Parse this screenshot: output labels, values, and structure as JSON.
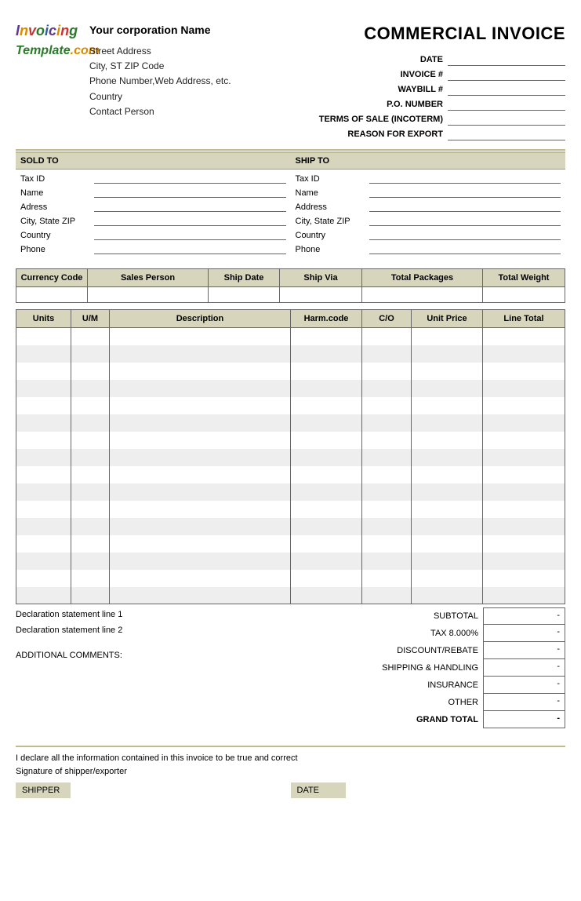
{
  "logo": {
    "line1_html": "Invoicing",
    "line2_html": "Template.com"
  },
  "company": {
    "name": "Your corporation  Name",
    "street": "Street Address",
    "city": "City, ST  ZIP Code",
    "phone": "Phone Number,Web Address, etc.",
    "country": "Country",
    "contact": "Contact Person"
  },
  "title": "COMMERCIAL INVOICE",
  "meta": {
    "date_lbl": "DATE",
    "date": "",
    "invoice_lbl": "INVOICE #",
    "invoice": "",
    "waybill_lbl": "WAYBILL #",
    "waybill": "",
    "po_lbl": "P.O. NUMBER",
    "po": "",
    "terms_lbl": "TERMS OF SALE (INCOTERM)",
    "terms": "",
    "reason_lbl": "REASON FOR EXPORT",
    "reason": ""
  },
  "sold": {
    "header": "SOLD  TO",
    "fields": {
      "taxid_lbl": "Tax ID",
      "taxid": "",
      "name_lbl": "Name",
      "name": "",
      "address_lbl": "Adress",
      "address": "",
      "csz_lbl": "City, State ZIP",
      "csz": "",
      "country_lbl": "Country",
      "country": "",
      "phone_lbl": "Phone",
      "phone": ""
    }
  },
  "ship": {
    "header": "SHIP TO",
    "fields": {
      "taxid_lbl": "Tax ID",
      "taxid": "",
      "name_lbl": "Name",
      "name": "",
      "address_lbl": "Address",
      "address": "",
      "csz_lbl": "City, State ZIP",
      "csz": "",
      "country_lbl": "Country",
      "country": "",
      "phone_lbl": "Phone",
      "phone": ""
    }
  },
  "info": {
    "h": {
      "currency": "Currency Code",
      "sales": "Sales Person",
      "shipdate": "Ship Date",
      "shipvia": "Ship Via",
      "packages": "Total Packages",
      "weight": "Total Weight"
    },
    "v": {
      "currency": "",
      "sales": "",
      "shipdate": "",
      "shipvia": "",
      "packages": "",
      "weight": ""
    }
  },
  "items": {
    "h": {
      "units": "Units",
      "um": "U/M",
      "desc": "Description",
      "harm": "Harm.code",
      "co": "C/O",
      "price": "Unit Price",
      "line": "Line Total"
    }
  },
  "decl": {
    "l1": "Declaration statement line 1",
    "l2": "Declaration statement line 2"
  },
  "addc_lbl": "ADDITIONAL COMMENTS:",
  "totals": {
    "subtotal_lbl": "SUBTOTAL",
    "subtotal": "-",
    "tax_lbl": "TAX  8.000%",
    "tax": "-",
    "discount_lbl": "DISCOUNT/REBATE",
    "discount": "-",
    "shipping_lbl": "SHIPPING & HANDLING",
    "shipping": "-",
    "insurance_lbl": "INSURANCE",
    "insurance": "-",
    "other_lbl": "OTHER",
    "other": "-",
    "grand_lbl": "GRAND TOTAL",
    "grand": "-"
  },
  "footer": {
    "decl1": "I declare all the information contained in this invoice to be true and correct",
    "decl2": "Signature of shipper/exporter",
    "shipper_lbl": "SHIPPER",
    "date_lbl": "DATE"
  }
}
